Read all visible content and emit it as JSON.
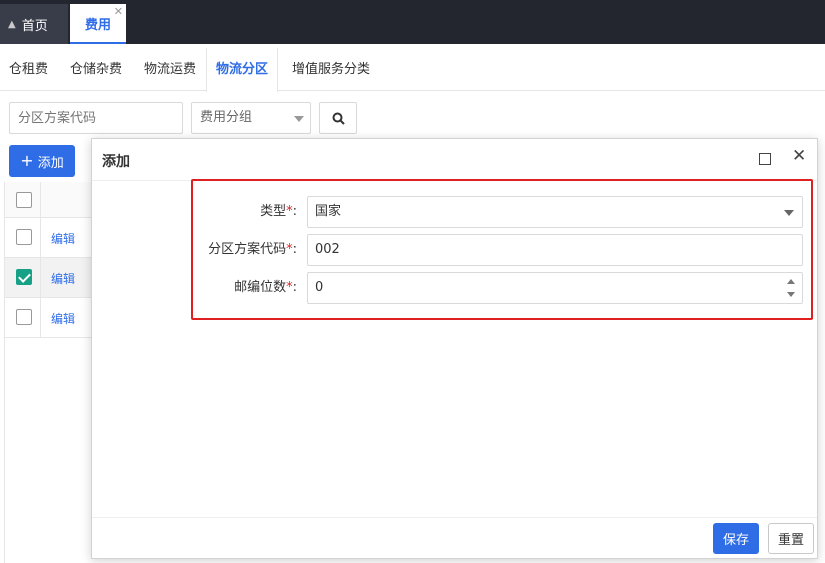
{
  "top_tabs": [
    {
      "label": "首页",
      "icon": "home-icon"
    },
    {
      "label": "费用",
      "active": true
    }
  ],
  "sub_tabs": [
    "仓租费",
    "仓储杂费",
    "物流运费",
    "物流分区",
    "增值服务分类"
  ],
  "active_sub_tab": "物流分区",
  "search": {
    "code_placeholder": "分区方案代码",
    "group_select_value": "费用分组"
  },
  "toolbar": {
    "add_label": "添加"
  },
  "table": {
    "rows": [
      {
        "action": "编辑",
        "checked": false
      },
      {
        "action": "编辑",
        "checked": true
      },
      {
        "action": "编辑",
        "checked": false
      }
    ]
  },
  "modal": {
    "title": "添加",
    "fields": [
      {
        "label": "类型",
        "required_mark": "*",
        "colon": ":",
        "value": "国家",
        "kind": "select"
      },
      {
        "label": "分区方案代码",
        "required_mark": "*",
        "colon": ":",
        "value": "002",
        "kind": "text"
      },
      {
        "label": "邮编位数",
        "required_mark": "*",
        "colon": ":",
        "value": "0",
        "kind": "number"
      }
    ],
    "save_label": "保存",
    "reset_label": "重置"
  },
  "colors": {
    "primary": "#2f6de6",
    "topbar": "#23262e",
    "highlight": "#e02020",
    "checked": "#16a085"
  }
}
